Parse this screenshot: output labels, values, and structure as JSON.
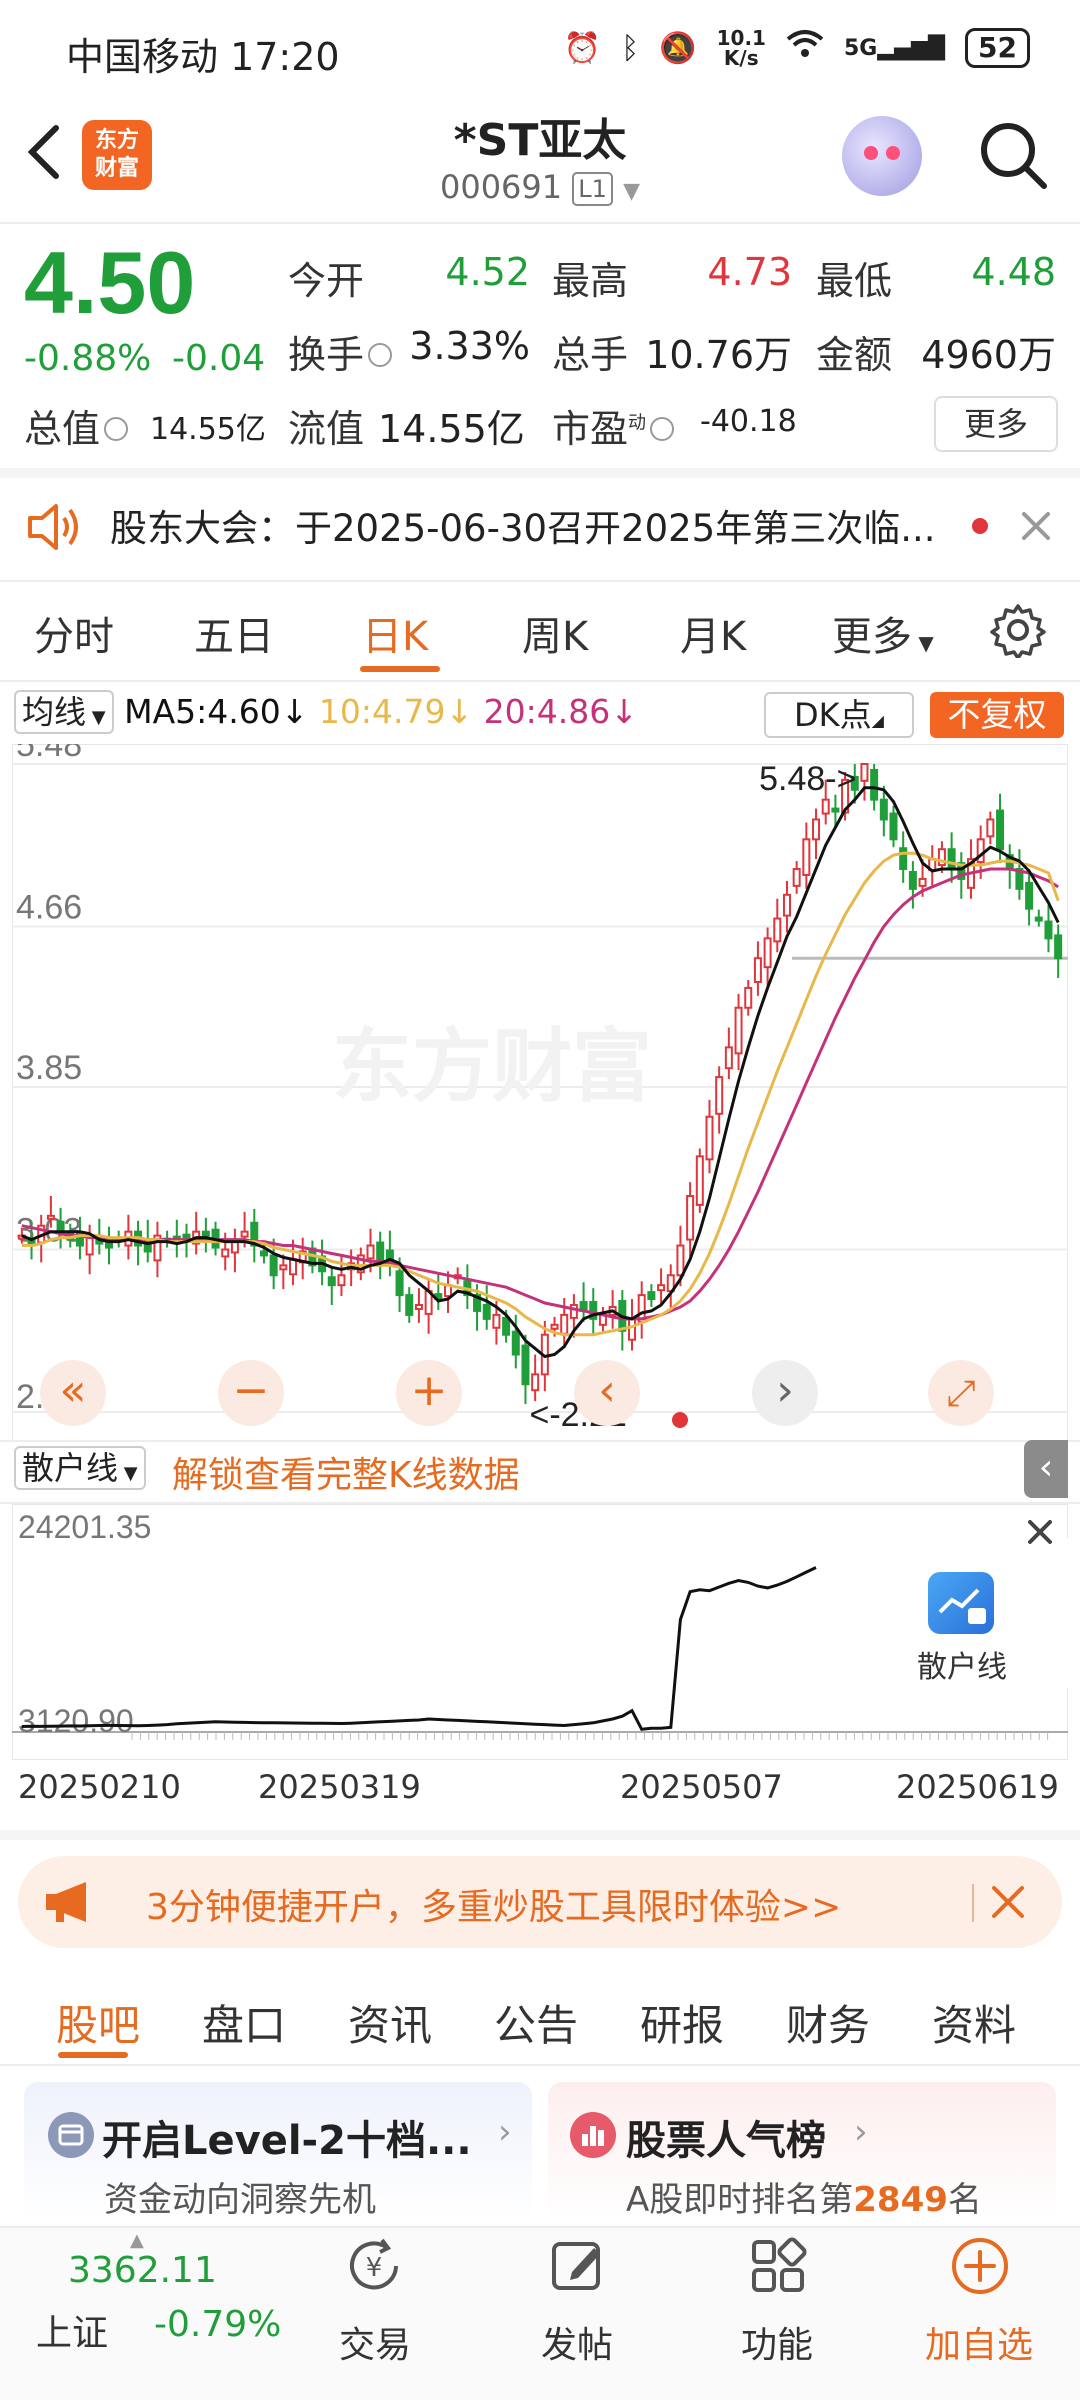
{
  "status_bar": {
    "carrier_time": "中国移动 17:20",
    "net_speed_value": "10.1",
    "net_speed_unit": "K/s",
    "signal": "5G",
    "battery": "52"
  },
  "header": {
    "logo_line1": "东方",
    "logo_line2": "财富",
    "title": "*ST亚太",
    "code": "000691",
    "level": "L1"
  },
  "quote": {
    "price": "4.50",
    "change_pct": "-0.88%",
    "change": "-0.04",
    "open_label": "今开",
    "open": "4.52",
    "high_label": "最高",
    "high": "4.73",
    "low_label": "最低",
    "low": "4.48",
    "turnover_label": "换手",
    "turnover": "3.33%",
    "volume_label": "总手",
    "volume": "10.76万",
    "amount_label": "金额",
    "amount": "4960万",
    "mktcap_label": "总值",
    "mktcap": "14.55亿",
    "float_label": "流值",
    "float_cap": "14.55亿",
    "pe_label": "市盈",
    "pe_sup": "动",
    "pe": "-40.18",
    "more": "更多"
  },
  "notice": {
    "text": "股东大会：于2025-06-30召开2025年第三次临..."
  },
  "kline_tabs": [
    "分时",
    "五日",
    "日K",
    "周K",
    "月K",
    "更多"
  ],
  "ma_row": {
    "select": "均线",
    "ma5": "MA5:4.60",
    "ma10": "10:4.79",
    "ma20": "20:4.86",
    "dk": "DK点",
    "fuquan": "不复权"
  },
  "colors": {
    "accent": "#e66a1f",
    "down": "#1f9e3a",
    "up": "#e0363b",
    "ma5": "#111111",
    "ma10": "#e8b84a",
    "ma20": "#c4327a"
  },
  "chart_data": [
    {
      "type": "candlestick",
      "y_ticks": [
        "5.48",
        "4.66",
        "3.85",
        "3.03",
        "2.21"
      ],
      "ylim": [
        2.21,
        5.48
      ],
      "max_annotation": "5.48->",
      "min_annotation": "<-2.21",
      "ref_line": 4.5,
      "closes": [
        3.1,
        3.05,
        3.15,
        3.2,
        3.12,
        3.08,
        3.05,
        3.1,
        3.06,
        3.04,
        3.08,
        3.12,
        3.05,
        3.02,
        3.1,
        3.08,
        3.06,
        3.09,
        3.12,
        3.1,
        3.04,
        3.03,
        3.08,
        3.12,
        3.05,
        3.0,
        2.9,
        2.95,
        2.98,
        3.02,
        2.95,
        2.92,
        2.85,
        2.9,
        2.96,
        3.0,
        3.05,
        2.98,
        2.95,
        2.8,
        2.7,
        2.75,
        2.82,
        2.78,
        2.85,
        2.9,
        2.8,
        2.72,
        2.68,
        2.7,
        2.6,
        2.5,
        2.35,
        2.4,
        2.6,
        2.65,
        2.7,
        2.75,
        2.72,
        2.68,
        2.7,
        2.74,
        2.62,
        2.68,
        2.8,
        2.78,
        2.85,
        2.9,
        3.05,
        3.3,
        3.5,
        3.7,
        3.9,
        4.05,
        4.25,
        4.35,
        4.5,
        4.6,
        4.7,
        4.82,
        4.95,
        5.1,
        5.2,
        5.3,
        5.25,
        5.4,
        5.35,
        5.48,
        5.3,
        5.2,
        5.1,
        4.95,
        4.85,
        4.9,
        5.0,
        5.05,
        4.95,
        4.9,
        5.0,
        5.1,
        5.2,
        5.05,
        4.95,
        4.85,
        4.75,
        4.7,
        4.6,
        4.5
      ],
      "ma5": [
        3.1,
        3.08,
        3.1,
        3.12,
        3.12,
        3.12,
        3.12,
        3.11,
        3.08,
        3.07,
        3.07,
        3.08,
        3.07,
        3.06,
        3.07,
        3.07,
        3.06,
        3.07,
        3.09,
        3.09,
        3.08,
        3.07,
        3.07,
        3.07,
        3.06,
        3.04,
        3.01,
        2.99,
        2.98,
        2.97,
        2.96,
        2.96,
        2.94,
        2.93,
        2.94,
        2.93,
        2.95,
        2.96,
        2.98,
        2.96,
        2.9,
        2.86,
        2.82,
        2.77,
        2.78,
        2.82,
        2.81,
        2.79,
        2.77,
        2.74,
        2.7,
        2.64,
        2.57,
        2.53,
        2.49,
        2.5,
        2.54,
        2.62,
        2.68,
        2.7,
        2.71,
        2.72,
        2.69,
        2.68,
        2.71,
        2.72,
        2.75,
        2.81,
        2.88,
        2.98,
        3.12,
        3.29,
        3.49,
        3.69,
        3.88,
        4.05,
        4.21,
        4.35,
        4.48,
        4.61,
        4.71,
        4.83,
        4.95,
        5.07,
        5.16,
        5.25,
        5.3,
        5.36,
        5.36,
        5.35,
        5.29,
        5.19,
        5.08,
        4.98,
        4.94,
        4.95,
        4.95,
        4.95,
        4.98,
        5.02,
        5.06,
        5.04,
        5.01,
        4.99,
        4.94,
        4.86,
        4.78,
        4.68
      ],
      "ma10": [
        3.05,
        3.05,
        3.06,
        3.08,
        3.09,
        3.09,
        3.1,
        3.1,
        3.1,
        3.09,
        3.09,
        3.09,
        3.09,
        3.08,
        3.08,
        3.07,
        3.07,
        3.07,
        3.07,
        3.07,
        3.07,
        3.07,
        3.07,
        3.07,
        3.07,
        3.06,
        3.04,
        3.03,
        3.02,
        3.01,
        3.0,
        2.99,
        2.97,
        2.96,
        2.95,
        2.95,
        2.95,
        2.95,
        2.95,
        2.94,
        2.92,
        2.9,
        2.88,
        2.86,
        2.85,
        2.84,
        2.83,
        2.82,
        2.8,
        2.78,
        2.76,
        2.73,
        2.69,
        2.66,
        2.63,
        2.61,
        2.6,
        2.6,
        2.6,
        2.6,
        2.61,
        2.62,
        2.63,
        2.64,
        2.66,
        2.68,
        2.7,
        2.73,
        2.77,
        2.83,
        2.91,
        3.01,
        3.13,
        3.26,
        3.4,
        3.54,
        3.67,
        3.8,
        3.93,
        4.05,
        4.17,
        4.29,
        4.41,
        4.52,
        4.62,
        4.72,
        4.8,
        4.88,
        4.94,
        4.99,
        5.02,
        5.03,
        5.03,
        5.02,
        5.0,
        4.99,
        4.98,
        4.97,
        4.97,
        4.97,
        4.98,
        4.99,
        4.99,
        4.98,
        4.97,
        4.95,
        4.93,
        4.79
      ],
      "ma20": [
        3.15,
        3.14,
        3.13,
        3.12,
        3.11,
        3.1,
        3.1,
        3.09,
        3.09,
        3.08,
        3.08,
        3.08,
        3.08,
        3.08,
        3.08,
        3.08,
        3.08,
        3.08,
        3.08,
        3.08,
        3.08,
        3.08,
        3.08,
        3.08,
        3.07,
        3.07,
        3.06,
        3.05,
        3.05,
        3.04,
        3.03,
        3.02,
        3.01,
        3.0,
        2.99,
        2.98,
        2.97,
        2.97,
        2.96,
        2.95,
        2.94,
        2.93,
        2.92,
        2.91,
        2.9,
        2.89,
        2.88,
        2.87,
        2.86,
        2.85,
        2.84,
        2.82,
        2.8,
        2.78,
        2.76,
        2.75,
        2.74,
        2.73,
        2.72,
        2.71,
        2.7,
        2.69,
        2.68,
        2.68,
        2.68,
        2.69,
        2.7,
        2.72,
        2.74,
        2.77,
        2.82,
        2.88,
        2.95,
        3.03,
        3.12,
        3.22,
        3.32,
        3.43,
        3.54,
        3.65,
        3.76,
        3.87,
        3.98,
        4.09,
        4.2,
        4.3,
        4.4,
        4.49,
        4.58,
        4.66,
        4.72,
        4.77,
        4.81,
        4.84,
        4.86,
        4.88,
        4.9,
        4.92,
        4.93,
        4.94,
        4.95,
        4.95,
        4.95,
        4.94,
        4.93,
        4.91,
        4.89,
        4.86
      ]
    },
    {
      "type": "line",
      "name": "散户线",
      "y_ticks": [
        "24201.35",
        "3120.90"
      ],
      "ylim": [
        3120.9,
        24201.35
      ],
      "x_ticks": [
        "20250210",
        "20250319",
        "20250507",
        "20250619"
      ],
      "values": [
        3500,
        3520,
        3510,
        3530,
        3540,
        3560,
        3550,
        3580,
        3600,
        3620,
        3610,
        3590,
        3570,
        3600,
        3650,
        3700,
        3800,
        3850,
        3900,
        3950,
        4000,
        3980,
        3960,
        3940,
        3920,
        3900,
        3890,
        3880,
        3870,
        3860,
        3850,
        3840,
        3830,
        3820,
        3850,
        3900,
        3950,
        4000,
        4050,
        4100,
        4150,
        4200,
        4300,
        4250,
        4200,
        4150,
        4100,
        4050,
        4000,
        3950,
        3900,
        3850,
        3800,
        3750,
        3700,
        3650,
        3600,
        3700,
        3800,
        3900,
        4100,
        4300,
        4600,
        5200,
        3200,
        3300,
        3300,
        3400,
        15000,
        18000,
        18200,
        18100,
        18500,
        18900,
        19200,
        19000,
        18600,
        18400,
        18700,
        19100,
        19600,
        20100,
        20600
      ]
    }
  ],
  "sanhu": {
    "select": "散户线",
    "unlock": "解锁查看完整K线数据",
    "promo_label": "散户线"
  },
  "banner": {
    "text": "3分钟便捷开户，多重炒股工具限时体验>>"
  },
  "bottom_tabs": [
    "股吧",
    "盘口",
    "资讯",
    "公告",
    "研报",
    "财务",
    "资料"
  ],
  "cards": {
    "left_title": "开启Level-2十档...",
    "left_sub": "资金动向洞察先机",
    "right_title": "股票人气榜",
    "right_sub_prefix": "A股即时排名第",
    "right_rank": "2849",
    "right_sub_suffix": "名"
  },
  "nav": {
    "index_value": "3362.11",
    "index_name": "上证",
    "index_change": "-0.79%",
    "trade": "交易",
    "post": "发帖",
    "function": "功能",
    "add_watch": "加自选"
  }
}
